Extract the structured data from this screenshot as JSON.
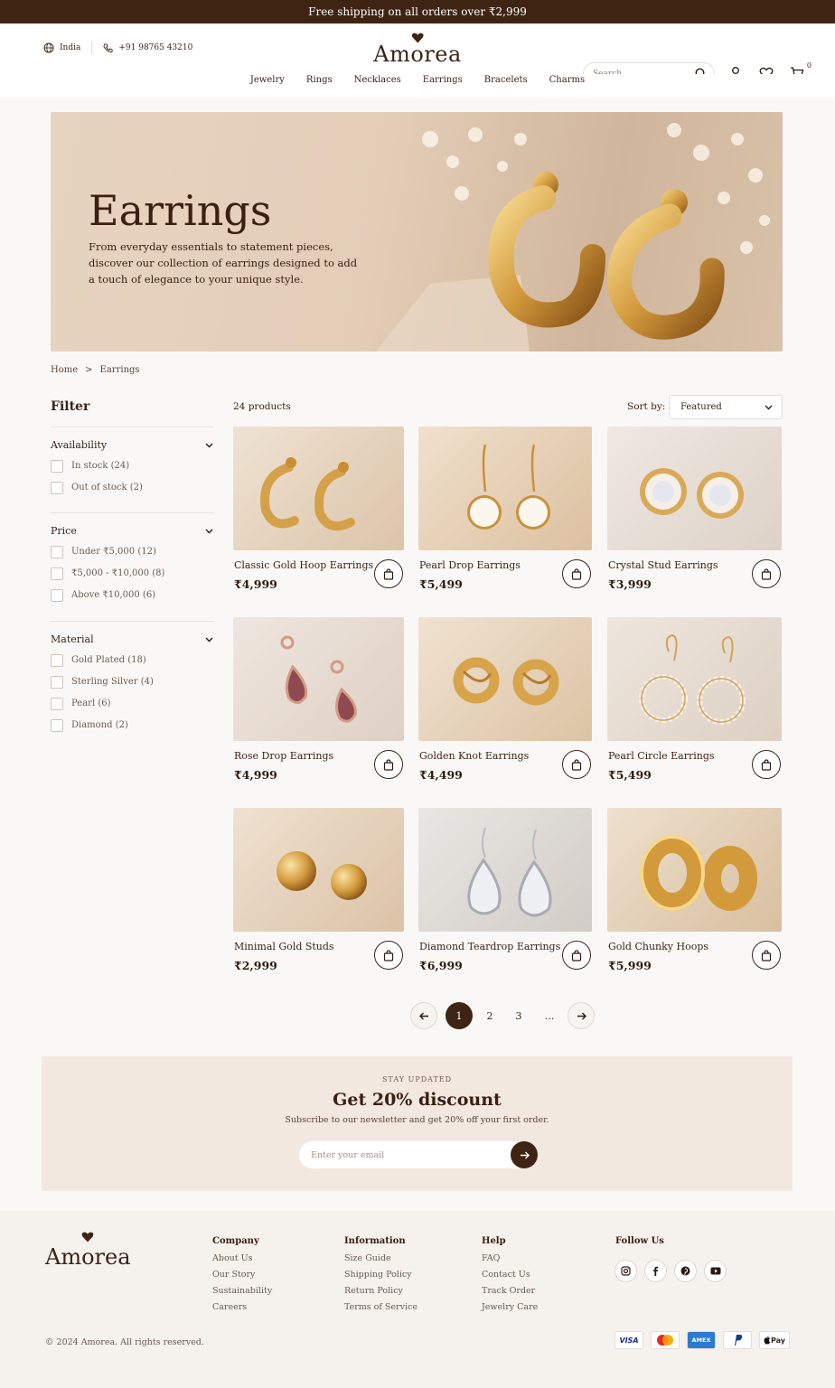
{
  "announcement": "Free shipping on all orders over ₹2,999",
  "header": {
    "region": "India",
    "phone": "+91 98765 43210",
    "brand": "Amorea",
    "search_placeholder": "Search...",
    "cart_count": "0"
  },
  "nav": [
    "Jewelry",
    "Rings",
    "Necklaces",
    "Earrings",
    "Bracelets",
    "Charms"
  ],
  "hero": {
    "title": "Earrings",
    "text": "From everyday essentials to statement pieces, discover our collection of earrings designed to add a touch of elegance to your unique style."
  },
  "breadcrumb": [
    "Home",
    "Earrings"
  ],
  "filter": {
    "title": "Filter",
    "groups": [
      {
        "label": "Availability",
        "options": [
          "In stock (24)",
          "Out of stock (2)"
        ]
      },
      {
        "label": "Price",
        "options": [
          "Under ₹5,000 (12)",
          "₹5,000 - ₹10,000 (8)",
          "Above ₹10,000 (6)"
        ]
      },
      {
        "label": "Material",
        "options": [
          "Gold Plated (18)",
          "Sterling Silver (4)",
          "Pearl (6)",
          "Diamond (2)"
        ]
      }
    ]
  },
  "listing": {
    "count": "24 products",
    "sort_label": "Sort by:",
    "sort_value": "Featured"
  },
  "products": [
    {
      "name": "Classic Gold Hoop Earrings",
      "price": "₹4,999"
    },
    {
      "name": "Pearl Drop Earrings",
      "price": "₹5,499"
    },
    {
      "name": "Crystal Stud Earrings",
      "price": "₹3,999"
    },
    {
      "name": "Rose Drop Earrings",
      "price": "₹4,999"
    },
    {
      "name": "Golden Knot Earrings",
      "price": "₹4,499"
    },
    {
      "name": "Pearl Circle Earrings",
      "price": "₹5,499"
    },
    {
      "name": "Minimal Gold Studs",
      "price": "₹2,999"
    },
    {
      "name": "Diamond Teardrop Earrings",
      "price": "₹6,999"
    },
    {
      "name": "Gold Chunky Hoops",
      "price": "₹5,999"
    }
  ],
  "pagination": {
    "pages": [
      "1",
      "2",
      "3",
      "..."
    ],
    "current": "1"
  },
  "newsletter": {
    "eyebrow": "STAY UPDATED",
    "title": "Get 20% discount",
    "text": "Subscribe to our newsletter and get 20% off your first order.",
    "placeholder": "Enter your email"
  },
  "footer": {
    "brand": "Amorea",
    "columns": [
      {
        "title": "Company",
        "links": [
          "About Us",
          "Our Story",
          "Sustainability",
          "Careers"
        ]
      },
      {
        "title": "Information",
        "links": [
          "Size Guide",
          "Shipping Policy",
          "Return Policy",
          "Terms of Service"
        ]
      },
      {
        "title": "Help",
        "links": [
          "FAQ",
          "Contact Us",
          "Track Order",
          "Jewelry Care"
        ]
      }
    ],
    "follow": "Follow Us",
    "copyright": "© 2024 Amorea. All rights reserved.",
    "payments": [
      "VISA",
      "AMEX",
      "Pay"
    ]
  },
  "colors": {
    "brand_dark": "#3f2413",
    "background": "#faf8f6",
    "gold": "#d8a24a"
  }
}
